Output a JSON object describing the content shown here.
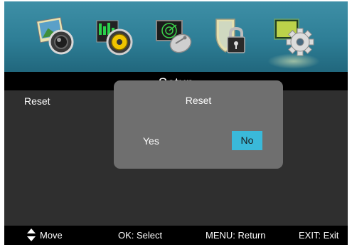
{
  "menu": {
    "icons": [
      {
        "name": "picture-icon",
        "active": false
      },
      {
        "name": "audio-icon",
        "active": false
      },
      {
        "name": "channel-icon",
        "active": false
      },
      {
        "name": "lock-icon",
        "active": false
      },
      {
        "name": "setup-icon",
        "active": true
      }
    ],
    "title": "Setup",
    "current_item": "Reset"
  },
  "dialog": {
    "title": "Reset",
    "yes_label": "Yes",
    "no_label": "No",
    "selected": "No"
  },
  "footer": {
    "move_label": "Move",
    "select_label": "OK: Select",
    "return_label": "MENU: Return",
    "exit_label": "EXIT: Exit"
  },
  "colors": {
    "iconbar": "#2e7e96",
    "highlight": "#3ab9d9",
    "dialog": "#6f6f6f",
    "panel": "#2f2f2f"
  }
}
